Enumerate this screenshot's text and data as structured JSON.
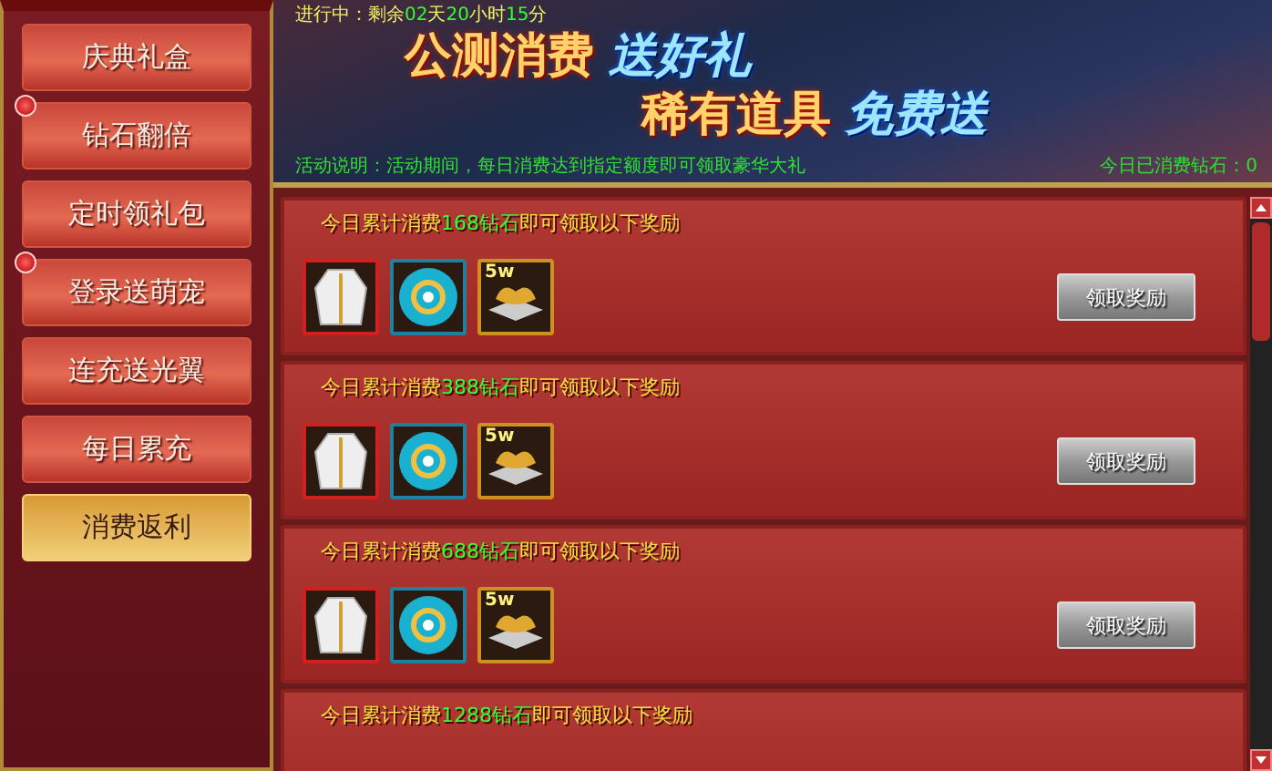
{
  "sidebar": {
    "items": [
      {
        "label": "庆典礼盒",
        "selected": false,
        "alert": false
      },
      {
        "label": "钻石翻倍",
        "selected": false,
        "alert": true
      },
      {
        "label": "定时领礼包",
        "selected": false,
        "alert": false
      },
      {
        "label": "登录送萌宠",
        "selected": false,
        "alert": true
      },
      {
        "label": "连充送光翼",
        "selected": false,
        "alert": false
      },
      {
        "label": "每日累充",
        "selected": false,
        "alert": false
      },
      {
        "label": "消费返利",
        "selected": true,
        "alert": false
      }
    ]
  },
  "banner": {
    "countdown": "进行中：剩余**02**天**20**小时**15**分",
    "headline": [
      {
        "warm": "公测消费",
        "cool": "送好礼"
      },
      {
        "warm": "稀有道具",
        "cool": "免费送"
      }
    ],
    "description": "活动说明：活动期间，每日消费达到指定额度即可领取豪华大礼",
    "spent": "今日已消费钻石：0"
  },
  "tiers": [
    {
      "title": "今日累计消费**168钻石**即可领取以下奖励",
      "items": [
        {
          "kind": "robe"
        },
        {
          "kind": "orb"
        },
        {
          "kind": "gold",
          "badge": "5w"
        }
      ],
      "button": "领取奖励"
    },
    {
      "title": "今日累计消费**388钻石**即可领取以下奖励",
      "items": [
        {
          "kind": "robe"
        },
        {
          "kind": "orb"
        },
        {
          "kind": "gold",
          "badge": "5w"
        }
      ],
      "button": "领取奖励"
    },
    {
      "title": "今日累计消费**688钻石**即可领取以下奖励",
      "items": [
        {
          "kind": "robe"
        },
        {
          "kind": "orb"
        },
        {
          "kind": "gold",
          "badge": "5w"
        }
      ],
      "button": "领取奖励"
    },
    {
      "title": "今日累计消费**1288钻石**即可领取以下奖励"
    }
  ]
}
